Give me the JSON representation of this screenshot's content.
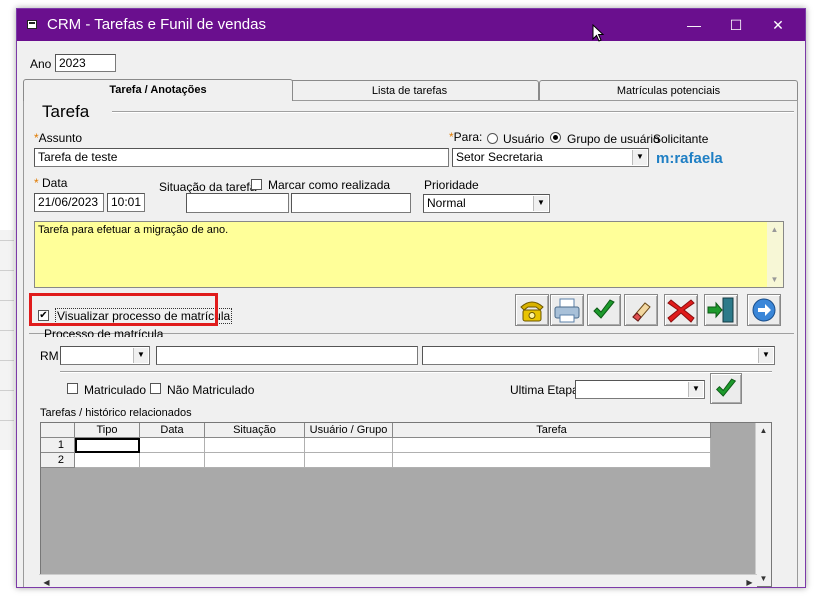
{
  "window": {
    "title": "CRM - Tarefas e Funil de vendas",
    "minimize": "—",
    "maximize": "☐",
    "close": "✕"
  },
  "year": {
    "label": "Ano",
    "value": "2023"
  },
  "tabs": [
    {
      "label": "Tarefa / Anotações",
      "active": true
    },
    {
      "label": "Lista de tarefas",
      "active": false
    },
    {
      "label": "Matrículas potenciais",
      "active": false
    }
  ],
  "section": {
    "title": "Tarefa"
  },
  "assunto": {
    "label": "Assunto",
    "value": "Tarefa de teste"
  },
  "para": {
    "label": "Para:",
    "option_usuario": "Usuário",
    "option_grupo": "Grupo de usuário",
    "selected": "Grupo de usuário",
    "solicitante_label": "Solicitante",
    "value": "Setor Secretaria"
  },
  "solicitante": {
    "name": "m:rafaela"
  },
  "data": {
    "label": "Data",
    "date": "21/06/2023",
    "time": "10:01"
  },
  "situacao": {
    "label": "Situação da tarefa",
    "marcar_label": "Marcar como realizada",
    "checked": false
  },
  "prioridade": {
    "label": "Prioridade",
    "value": "Normal"
  },
  "descricao": {
    "text": "Tarefa para efetuar a migração de ano."
  },
  "visualizar": {
    "label": "Visualizar processo de matrícula",
    "checked": true
  },
  "processo": {
    "title": "Processo de matrícula",
    "rm_label": "RM"
  },
  "filters": {
    "matriculado_label": "Matriculado",
    "nao_matriculado_label": "Não Matriculado",
    "ultima_etapa_label": "Ultima Etapa"
  },
  "related": {
    "title": "Tarefas / histórico relacionados",
    "columns": [
      "Tipo",
      "Data",
      "Situação",
      "Usuário / Grupo",
      "Tarefa"
    ],
    "rows": [
      {
        "num": "1",
        "cells": [
          "",
          "",
          "",
          "",
          ""
        ]
      },
      {
        "num": "2",
        "cells": [
          "",
          "",
          "",
          "",
          ""
        ]
      }
    ]
  },
  "colors": {
    "titlebar": "#6a0f8e",
    "note_bg": "#ffff99",
    "highlight": "#e01b1b",
    "brand_blue": "#1f7fc4"
  }
}
